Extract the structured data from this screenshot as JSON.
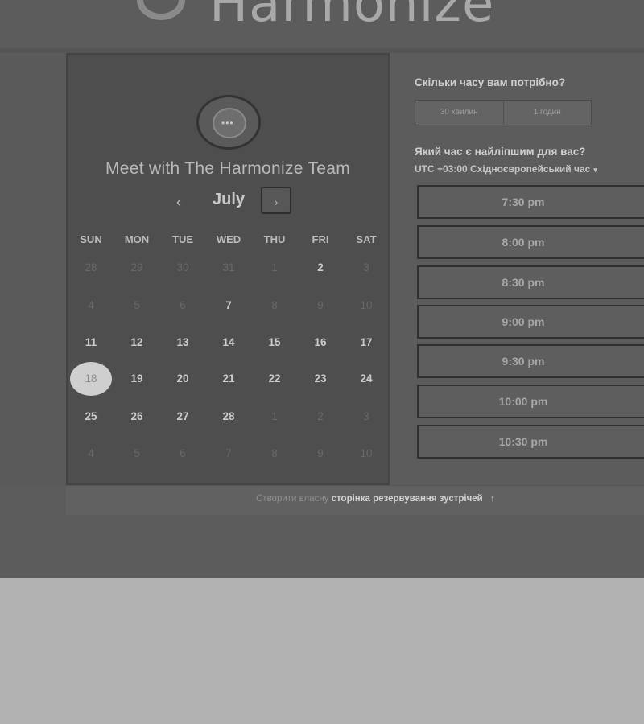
{
  "brand": {
    "name": "Harmonize",
    "logo_icon": "chat-bubble-logo-icon"
  },
  "calendar": {
    "title": "Meet with The Harmonize Team",
    "month": "July",
    "prev_icon": "‹",
    "next_icon": "›",
    "weekdays": [
      "SUN",
      "MON",
      "TUE",
      "WED",
      "THU",
      "FRI",
      "SAT"
    ],
    "weeks": [
      [
        {
          "d": "28",
          "m": true
        },
        {
          "d": "29",
          "m": true
        },
        {
          "d": "30",
          "m": true
        },
        {
          "d": "31",
          "m": true
        },
        {
          "d": "1",
          "m": true
        },
        {
          "d": "2",
          "m": false
        },
        {
          "d": "3",
          "m": true
        }
      ],
      [
        {
          "d": "4",
          "m": true
        },
        {
          "d": "5",
          "m": true
        },
        {
          "d": "6",
          "m": true
        },
        {
          "d": "7",
          "m": false
        },
        {
          "d": "8",
          "m": true
        },
        {
          "d": "9",
          "m": true
        },
        {
          "d": "10",
          "m": true
        }
      ],
      [
        {
          "d": "11",
          "m": false
        },
        {
          "d": "12",
          "m": false
        },
        {
          "d": "13",
          "m": false
        },
        {
          "d": "14",
          "m": false
        },
        {
          "d": "15",
          "m": false
        },
        {
          "d": "16",
          "m": false
        },
        {
          "d": "17",
          "m": false
        }
      ],
      [
        {
          "d": "18",
          "m": false,
          "selected": true
        },
        {
          "d": "19",
          "m": false
        },
        {
          "d": "20",
          "m": false
        },
        {
          "d": "21",
          "m": false
        },
        {
          "d": "22",
          "m": false
        },
        {
          "d": "23",
          "m": false
        },
        {
          "d": "24",
          "m": false
        }
      ],
      [
        {
          "d": "25",
          "m": false
        },
        {
          "d": "26",
          "m": false
        },
        {
          "d": "27",
          "m": false
        },
        {
          "d": "28",
          "m": false
        },
        {
          "d": "1",
          "m": true
        },
        {
          "d": "2",
          "m": true
        },
        {
          "d": "3",
          "m": true
        }
      ],
      [
        {
          "d": "4",
          "m": true
        },
        {
          "d": "5",
          "m": true
        },
        {
          "d": "6",
          "m": true
        },
        {
          "d": "7",
          "m": true
        },
        {
          "d": "8",
          "m": true
        },
        {
          "d": "9",
          "m": true
        },
        {
          "d": "10",
          "m": true
        }
      ]
    ]
  },
  "booking": {
    "duration_question": "Скільки часу вам потрібно?",
    "durations": [
      "30 хвилин",
      "1 годин"
    ],
    "time_question": "Який час є найліпшим для вас?",
    "timezone": "UTC +03:00 Східноєвропейський час",
    "timezone_icon": "▾",
    "slots": [
      "7:30 pm",
      "8:00 pm",
      "8:30 pm",
      "9:00 pm",
      "9:30 pm",
      "10:00 pm",
      "10:30 pm"
    ]
  },
  "footer": {
    "prefix": "Створити власну",
    "link": "сторінка резервування зустрічей",
    "arrow": "↑"
  }
}
